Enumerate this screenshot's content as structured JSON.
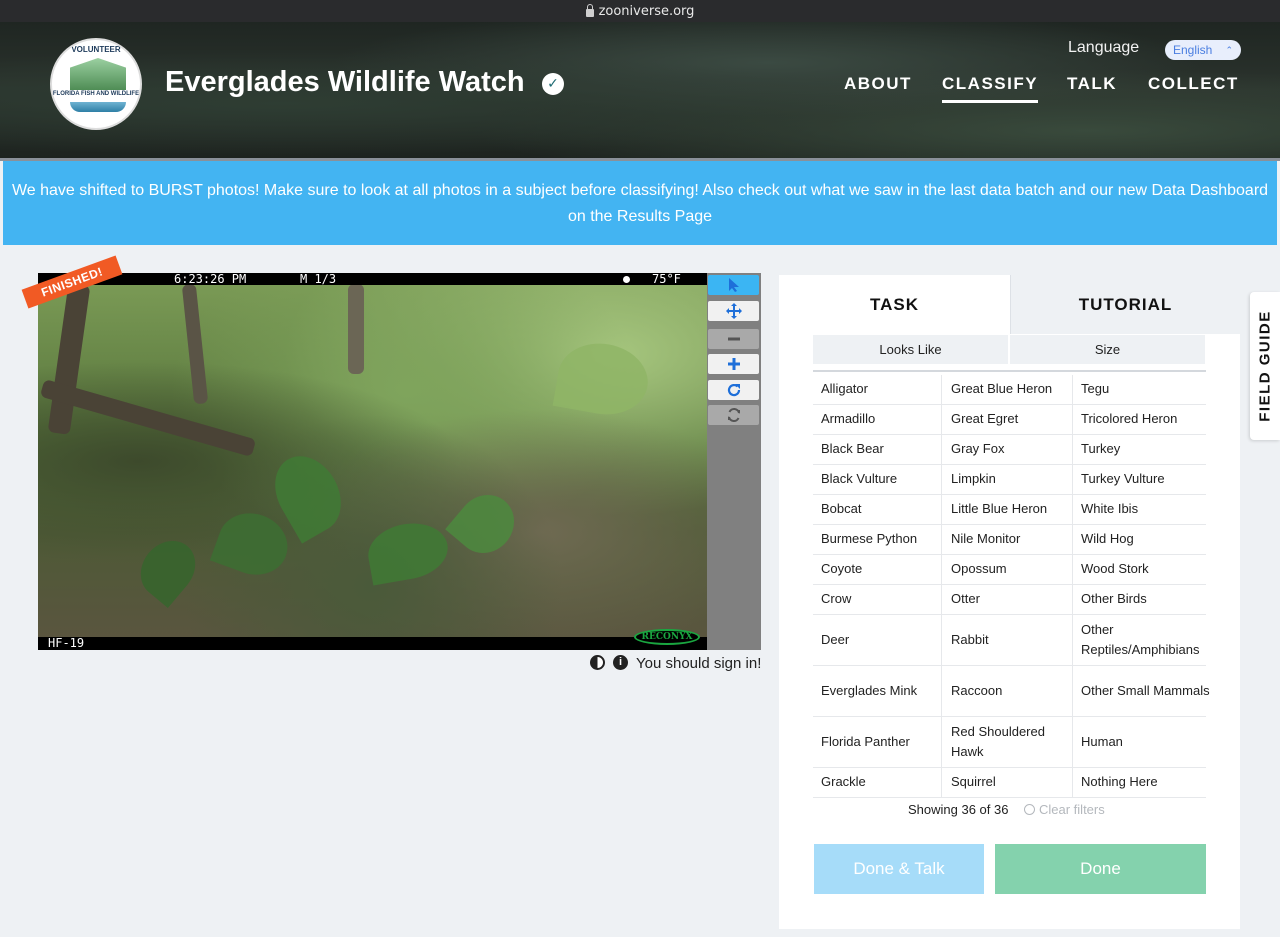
{
  "browser": {
    "url": "zooniverse.org"
  },
  "header": {
    "logo": {
      "top_text": "VOLUNTEER",
      "mid_text": "FLORIDA FISH AND WILDLIFE"
    },
    "title": "Everglades Wildlife Watch",
    "nav": [
      "ABOUT",
      "CLASSIFY",
      "TALK",
      "COLLECT"
    ],
    "active_nav": "CLASSIFY",
    "language_label": "Language",
    "language_value": "English"
  },
  "announcement": "We have shifted to BURST photos! Make sure to look at all photos in a subject before classifying! Also check out what we saw in the last data batch and our new Data Dashboard on the Results Page",
  "subject": {
    "badge": "FINISHED!",
    "stamp_time": "6:23:26 PM",
    "stamp_frame": "M 1/3",
    "stamp_temp": "75°F",
    "camera_id": "HF-19",
    "camera_brand": "RECONYX",
    "sign_in_text": "You should sign in!"
  },
  "task": {
    "tabs": [
      "TASK",
      "TUTORIAL"
    ],
    "filters": [
      "Looks Like",
      "Size"
    ],
    "choices": [
      [
        "Alligator",
        "Great Blue Heron",
        "Tegu"
      ],
      [
        "Armadillo",
        "Great Egret",
        "Tricolored Heron"
      ],
      [
        "Black Bear",
        "Gray Fox",
        "Turkey"
      ],
      [
        "Black Vulture",
        "Limpkin",
        "Turkey Vulture"
      ],
      [
        "Bobcat",
        "Little Blue Heron",
        "White Ibis"
      ],
      [
        "Burmese Python",
        "Nile Monitor",
        "Wild Hog"
      ],
      [
        "Coyote",
        "Opossum",
        "Wood Stork"
      ],
      [
        "Crow",
        "Otter",
        "Other Birds"
      ],
      [
        "Deer",
        "Rabbit",
        "Other Reptiles/Amphibians"
      ],
      [
        "Everglades Mink",
        "Raccoon",
        "Other Small Mammals"
      ],
      [
        "Florida Panther",
        "Red Shouldered Hawk",
        "Human"
      ],
      [
        "Grackle",
        "Squirrel",
        "Nothing Here"
      ]
    ],
    "showing": "Showing 36 of 36",
    "clear_filters": "Clear filters",
    "done_talk": "Done & Talk",
    "done": "Done"
  },
  "field_guide": "FIELD GUIDE",
  "colors": {
    "banner": "#43b4f2",
    "badge": "#f15a24",
    "done": "#84d2ad",
    "done_talk": "#a6dcf9"
  }
}
